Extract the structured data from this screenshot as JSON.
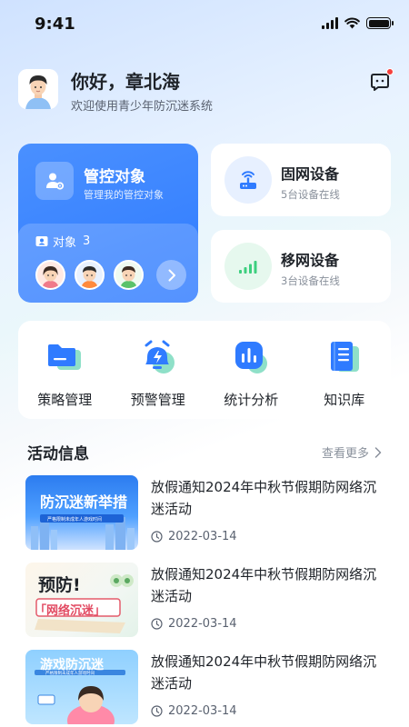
{
  "status_bar": {
    "time": "9:41"
  },
  "header": {
    "greeting": "你好，章北海",
    "welcome": "欢迎使用青少年防沉迷系统"
  },
  "control_card": {
    "title": "管控对象",
    "subtitle": "管理我的管控对象",
    "objects_label": "对象",
    "objects_count": "3"
  },
  "devices": {
    "fixed": {
      "title": "固网设备",
      "subtitle": "5台设备在线"
    },
    "mobile": {
      "title": "移网设备",
      "subtitle": "3台设备在线"
    }
  },
  "quick_menu": [
    {
      "label": "策略管理",
      "icon": "folder-icon"
    },
    {
      "label": "预警管理",
      "icon": "alarm-icon"
    },
    {
      "label": "统计分析",
      "icon": "chart-icon"
    },
    {
      "label": "知识库",
      "icon": "book-icon"
    }
  ],
  "activity": {
    "section_title": "活动信息",
    "see_more": "查看更多",
    "items": [
      {
        "title": "放假通知2024年中秋节假期防网络沉迷活动",
        "date": "2022-03-14",
        "thumb_title": "防沉迷新举措",
        "thumb_sub": "严格限制未成年人游戏时间"
      },
      {
        "title": "放假通知2024年中秋节假期防网络沉迷活动",
        "date": "2022-03-14",
        "thumb_title": "预防!",
        "thumb_sub": "「网络沉迷」"
      },
      {
        "title": "放假通知2024年中秋节假期防网络沉迷活动",
        "date": "2022-03-14",
        "thumb_title": "游戏防沉迷",
        "thumb_sub": "严格限制未成年人游戏时间"
      }
    ]
  },
  "colors": {
    "primary": "#2f7bff",
    "accent_green": "#3ccf7e",
    "alert_red": "#f5413e"
  }
}
